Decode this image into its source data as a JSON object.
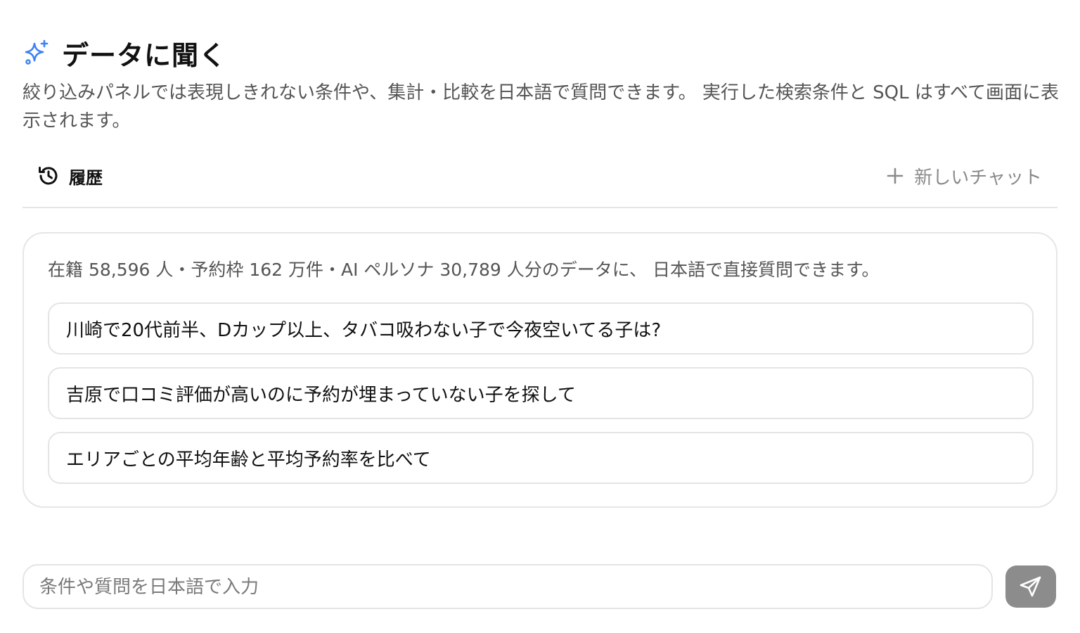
{
  "header": {
    "title": "データに聞く",
    "icon": "sparkle-icon",
    "accent_color": "#3b82f6",
    "description": "絞り込みパネルでは表現しきれない条件や、集計・比較を日本語で質問できます。 実行した検索条件と SQL はすべて画面に表示されます。"
  },
  "toolbar": {
    "history_label": "履歴",
    "history_icon": "history-icon",
    "new_chat_label": "新しいチャット",
    "new_chat_icon": "plus-icon"
  },
  "card": {
    "intro": "在籍 58,596 人・予約枠 162 万件・AI ペルソナ 30,789 人分のデータに、 日本語で直接質問できます。",
    "suggestions": [
      "川崎で20代前半、Dカップ以上、タバコ吸わない子で今夜空いてる子は?",
      "吉原で口コミ評価が高いのに予約が埋まっていない子を探して",
      "エリアごとの平均年齢と平均予約率を比べて"
    ]
  },
  "composer": {
    "value": "",
    "placeholder": "条件や質問を日本語で入力",
    "send_icon": "send-icon",
    "send_button_color": "#8c8c8c"
  }
}
